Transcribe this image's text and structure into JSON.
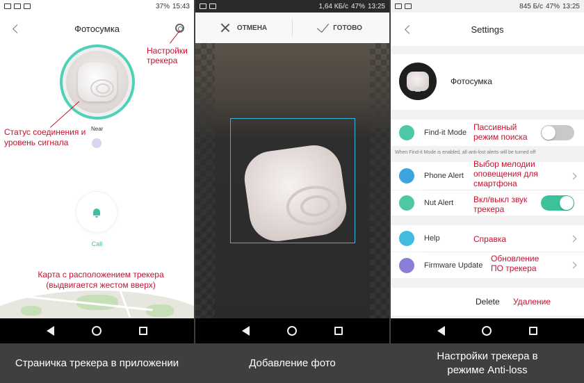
{
  "panel1": {
    "status": {
      "battery": "37%",
      "time": "15:43"
    },
    "title": "Фотосумка",
    "proximity": "Near",
    "call_label": "Call",
    "annotations": {
      "settings": "Настройки трекера",
      "connection": "Статус соединения и уровень сигнала",
      "map": "Карта с расположением трекера (выдвигается жестом вверх)"
    },
    "caption": "Страничка трекера в приложении"
  },
  "panel2": {
    "status": {
      "speed": "1,64 КБ/с",
      "battery": "47%",
      "time": "13:25"
    },
    "cancel_label": "ОТМЕНА",
    "done_label": "ГОТОВО",
    "caption": "Добавление фото"
  },
  "panel3": {
    "status": {
      "speed": "845 Б/с",
      "battery": "47%",
      "time": "13:25"
    },
    "title": "Settings",
    "device_name": "Фотосумка",
    "rows": {
      "findit": {
        "label": "Find-it Mode",
        "annotation": "Пассивный режим поиска",
        "on": false
      },
      "note": "When Find-it Mode is enabled, all anti-lost alerts will be turned off",
      "phone_alert": {
        "label": "Phone Alert",
        "annotation": "Выбор мелодии оповещения для смартфона"
      },
      "nut_alert": {
        "label": "Nut Alert",
        "annotation": "Вкл/выкл звук трекера",
        "on": true
      },
      "help": {
        "label": "Help",
        "annotation": "Справка"
      },
      "firmware": {
        "label": "Firmware Update",
        "annotation": "Обновление ПО трекера"
      }
    },
    "delete_label": "Delete",
    "delete_annotation": "Удаление",
    "caption": "Настройки трекера в режиме Anti-loss"
  },
  "colors": {
    "accent": "#4fd1b7",
    "annotation_red": "#c8102e",
    "crop_blue": "#3ab4e0",
    "toggle_on": "#3cc29a"
  }
}
